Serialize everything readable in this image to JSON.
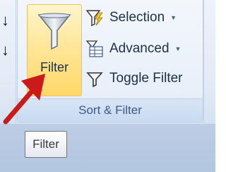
{
  "ribbon": {
    "group_label": "Sort & Filter",
    "filter_button_label": "Filter",
    "commands": [
      {
        "label": "Selection",
        "icon": "selection-filter-icon",
        "dropdown": "▼"
      },
      {
        "label": "Advanced",
        "icon": "advanced-filter-icon",
        "dropdown": "▼"
      },
      {
        "label": "Toggle Filter",
        "icon": "toggle-filter-icon",
        "dropdown": ""
      }
    ]
  },
  "tooltip": {
    "text": "Filter"
  },
  "colors": {
    "highlight": "#ffd868",
    "group_label_text": "#3b5a8a",
    "annotation_arrow": "#cc1a1a"
  }
}
